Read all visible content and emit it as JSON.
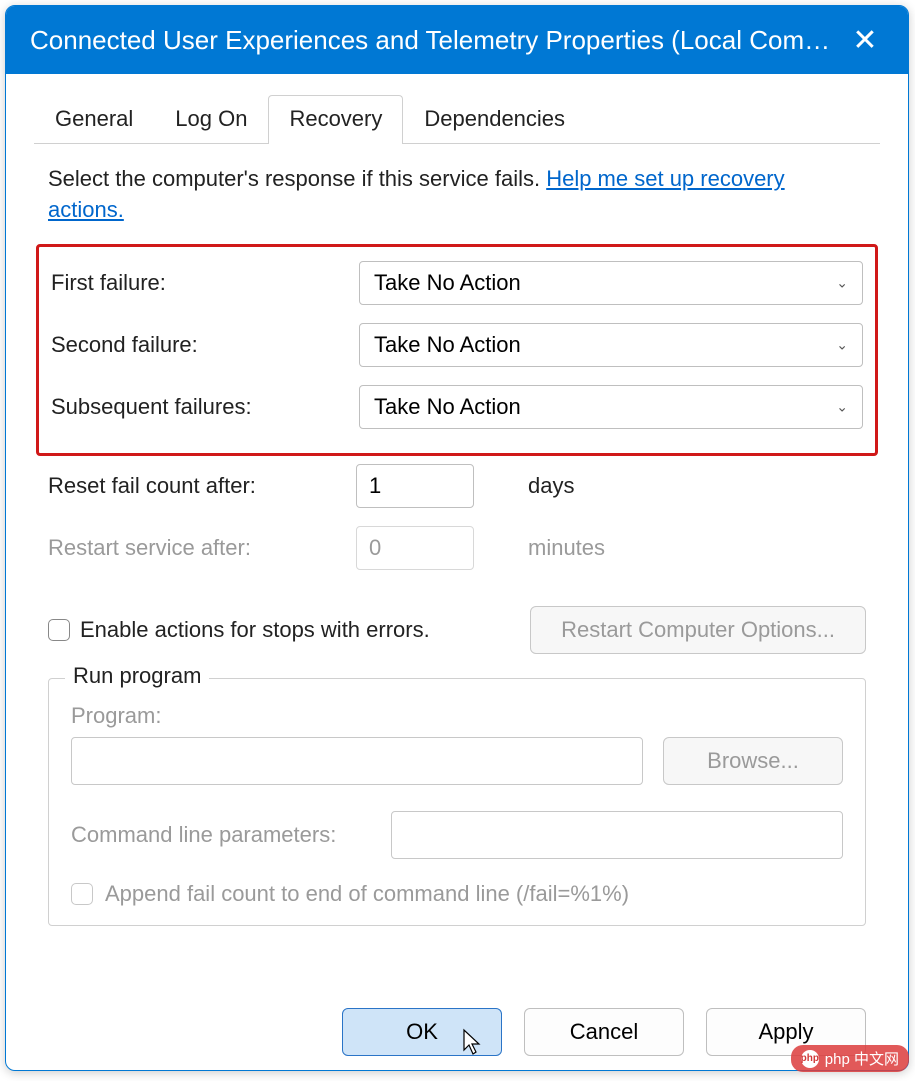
{
  "window": {
    "title": "Connected User Experiences and Telemetry Properties (Local Comp..."
  },
  "tabs": {
    "general": "General",
    "logon": "Log On",
    "recovery": "Recovery",
    "dependencies": "Dependencies",
    "active": "recovery"
  },
  "intro": {
    "text": "Select the computer's response if this service fails. ",
    "link": "Help me set up recovery actions."
  },
  "failures": {
    "first_label": "First failure:",
    "first_value": "Take No Action",
    "second_label": "Second failure:",
    "second_value": "Take No Action",
    "subsequent_label": "Subsequent failures:",
    "subsequent_value": "Take No Action"
  },
  "reset": {
    "label": "Reset fail count after:",
    "value": "1",
    "unit": "days"
  },
  "restart": {
    "label": "Restart service after:",
    "value": "0",
    "unit": "minutes"
  },
  "enable_actions": {
    "label": "Enable actions for stops with errors.",
    "checked": false
  },
  "restart_computer_button": "Restart Computer Options...",
  "run_program": {
    "legend": "Run program",
    "program_label": "Program:",
    "program_value": "",
    "browse": "Browse...",
    "cmd_label": "Command line parameters:",
    "cmd_value": "",
    "append_label": "Append fail count to end of command line (/fail=%1%)",
    "append_checked": false
  },
  "buttons": {
    "ok": "OK",
    "cancel": "Cancel",
    "apply": "Apply"
  },
  "watermark": "php 中文网"
}
